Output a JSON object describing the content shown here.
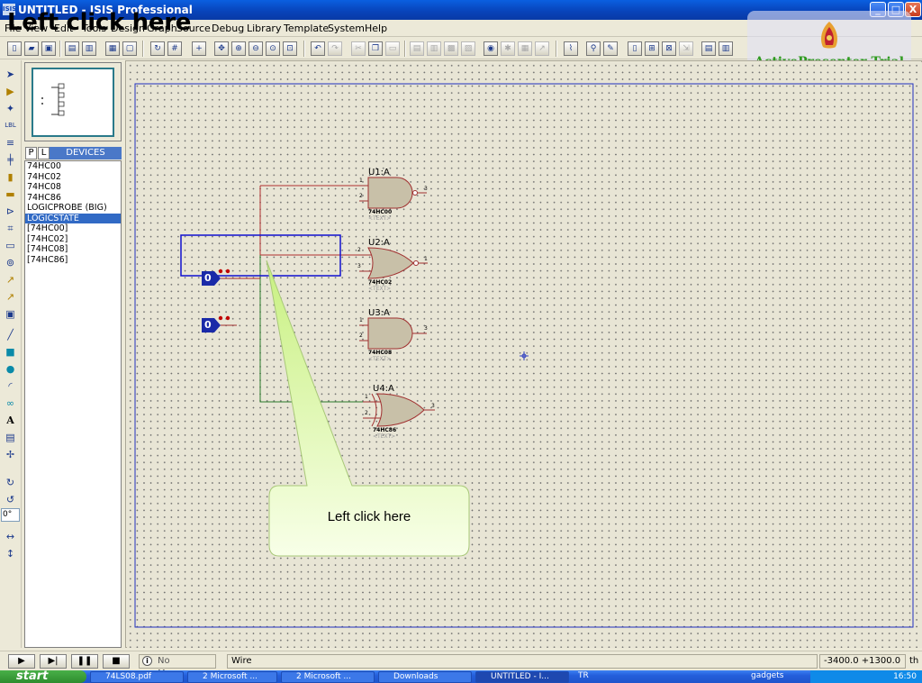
{
  "window": {
    "title": "UNTITLED - ISIS Professional",
    "app_badge": "ISIS",
    "buttons": [
      "_",
      "□",
      "X"
    ]
  },
  "headline": "Left click here",
  "menu": [
    "File",
    "View",
    "Edit",
    "Tools",
    "Design",
    "Graph",
    "Source",
    "Debug",
    "Library",
    "Template",
    "System",
    "Help"
  ],
  "toolbar": {
    "icons": [
      "new-icon",
      "open-icon",
      "save-icon",
      "import-icon",
      "export-icon",
      "print-icon",
      "area-icon",
      "redraw-icon",
      "grid-icon",
      "origin-icon",
      "pan-icon",
      "zoom-in-icon",
      "zoom-out-icon",
      "zoom-all-icon",
      "zoom-area-icon",
      "undo-icon",
      "redo-icon",
      "cut-icon",
      "copy-icon",
      "paste-icon",
      "block-copy-icon",
      "block-move-icon",
      "block-rotate-icon",
      "block-delete-icon",
      "pick-device-icon",
      "make-device-icon",
      "package-icon",
      "decompose-icon",
      "wire-autorouter-icon",
      "search-icon",
      "property-icon",
      "new-sheet-icon",
      "remove-sheet-icon",
      "exit-parent-icon",
      "bill-of-materials-icon",
      "erc-icon",
      "netlist-icon"
    ]
  },
  "lefttools": {
    "angle": "0°"
  },
  "trial": {
    "text": "ActivePresenter Trial"
  },
  "devices": {
    "tabs": [
      "P",
      "L"
    ],
    "header": "DEVICES",
    "items": [
      "74HC00",
      "74HC02",
      "74HC08",
      "74HC86",
      "LOGICPROBE (BIG)",
      "LOGICSTATE",
      "[74HC00]",
      "[74HC02]",
      "[74HC08]",
      "[74HC86]"
    ],
    "selected": "LOGICSTATE"
  },
  "schematic": {
    "gates": [
      {
        "ref": "U1:A",
        "part": "74HC00",
        "text": "<TEXT>",
        "pins": [
          "1",
          "2",
          "3"
        ]
      },
      {
        "ref": "U2:A",
        "part": "74HC02",
        "text": "<TEXT>",
        "pins": [
          "2",
          "3",
          "1"
        ]
      },
      {
        "ref": "U3:A",
        "part": "74HC08",
        "text": "<TEXT>",
        "pins": [
          "1",
          "2",
          "3"
        ]
      },
      {
        "ref": "U4:A",
        "part": "74HC86",
        "text": "<TEXT>",
        "pins": [
          "1",
          "2",
          "3"
        ]
      }
    ],
    "logic_states": [
      "0",
      "0"
    ]
  },
  "callout": {
    "text": "Left click here"
  },
  "statusbar": {
    "sim_buttons": [
      "▶",
      "▶|",
      "❚❚",
      "■"
    ],
    "messages": "No Messages",
    "mode": "Wire",
    "coords": "-3400.0  +1300.0",
    "unit": "th"
  },
  "taskbar": {
    "start": "start",
    "tasks": [
      "74LS08.pdf",
      "2 Microsoft ...",
      "2 Microsoft ...",
      "Downloads",
      "UNTITLED - I..."
    ],
    "tray_items": [
      "TR",
      "gadgets"
    ],
    "clock": "16:50"
  }
}
